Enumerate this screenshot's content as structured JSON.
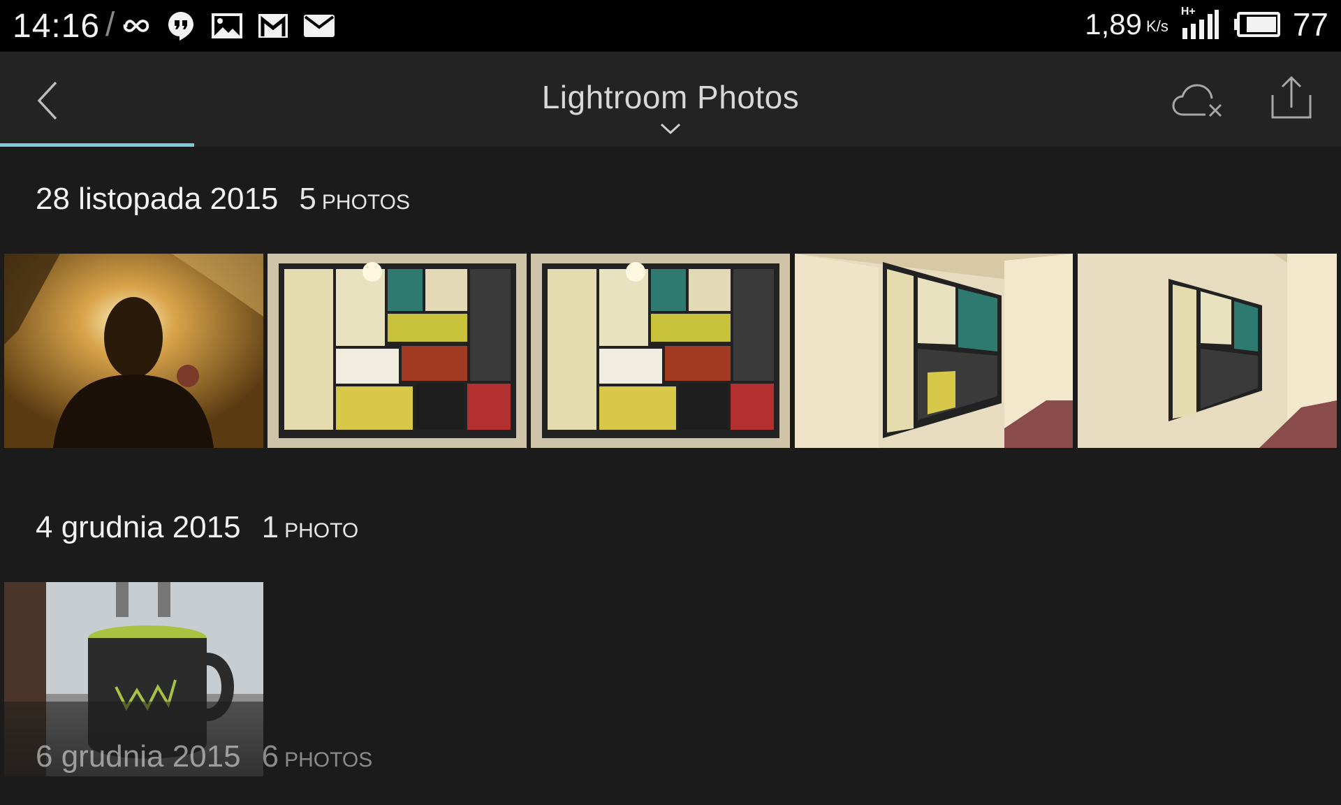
{
  "status_bar": {
    "time": "14:16",
    "separator": "/",
    "notification_icons": [
      "infinity-icon",
      "hangouts-icon",
      "gallery-icon",
      "gmail-icon",
      "mail-icon"
    ],
    "net_speed": "1,89",
    "net_speed_unit": "K/s",
    "network_type": "H+",
    "battery_level": "77"
  },
  "app_bar": {
    "title": "Lightroom Photos",
    "load_progress": 0.145,
    "accent_color": "#7fc8e0"
  },
  "sections": [
    {
      "date": "28 listopada 2015",
      "count": "5",
      "count_label": "PHOTOS",
      "photos": [
        "portrait-photo",
        "ticket-wall-photo",
        "ticket-wall-photo",
        "ticket-wall-angled-photo",
        "ticket-wall-angled-photo"
      ]
    },
    {
      "date": "4 grudnia 2015",
      "count": "1",
      "count_label": "PHOTO",
      "photos": [
        "coffee-mug-photo"
      ]
    },
    {
      "date": "6 grudnia 2015",
      "count": "6",
      "count_label": "PHOTOS",
      "photos": []
    }
  ]
}
